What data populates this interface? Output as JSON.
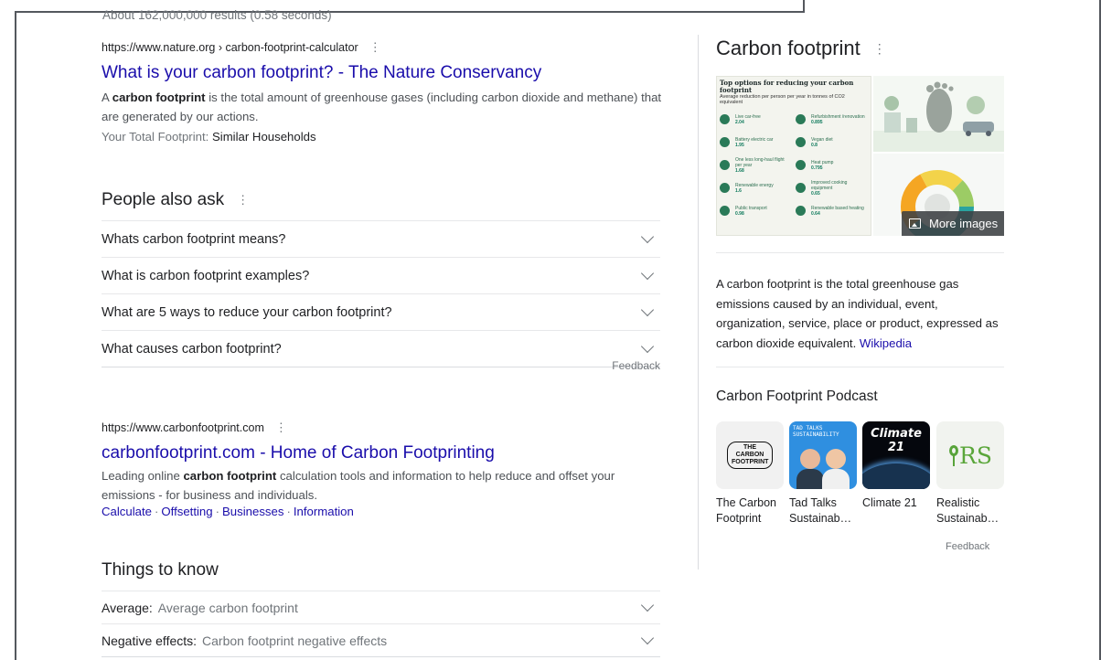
{
  "stats": "About 162,000,000 results (0.58 seconds)",
  "result1": {
    "cite": "https://www.nature.org › carbon-footprint-calculator",
    "title": "What is your carbon footprint? - The Nature Conservancy",
    "snippet_pre": "A ",
    "snippet_bold": "carbon footprint",
    "snippet_post": " is the total amount of greenhouse gases (including carbon dioxide and methane) that are generated by our actions.",
    "extra_label": "Your Total Footprint: ",
    "extra_value": "Similar Households"
  },
  "paa": {
    "title": "People also ask",
    "questions": [
      "Whats carbon footprint means?",
      "What is carbon footprint examples?",
      "What are 5 ways to reduce your carbon footprint?",
      "What causes carbon footprint?"
    ],
    "feedback": "Feedback"
  },
  "result2": {
    "cite": "https://www.carbonfootprint.com",
    "title": "carbonfootprint.com - Home of Carbon Footprinting",
    "snippet_pre": "Leading online ",
    "snippet_bold": "carbon footprint",
    "snippet_post": " calculation tools and information to help reduce and offset your emissions - for business and individuals.",
    "sitelinks": [
      "Calculate",
      "Offsetting",
      "Businesses",
      "Information"
    ]
  },
  "things_to_know": {
    "title": "Things to know",
    "items": [
      {
        "label": "Average:",
        "value": "Average carbon footprint"
      },
      {
        "label": "Negative effects:",
        "value": "Carbon footprint negative effects"
      }
    ]
  },
  "knowledge_panel": {
    "title": "Carbon footprint",
    "infographic": {
      "heading": "Top options for reducing your carbon footprint",
      "subheading": "Average reduction per person per year in tonnes of CO2 equivalent",
      "items": [
        {
          "label": "Live car-free",
          "value": "2.04"
        },
        {
          "label": "Refurbishment /renovation",
          "value": "0.895"
        },
        {
          "label": "Battery electric car",
          "value": "1.95"
        },
        {
          "label": "Vegan diet",
          "value": "0.8"
        },
        {
          "label": "One less long-haul flight per year",
          "value": "1.68"
        },
        {
          "label": "Heat pump",
          "value": "0.795"
        },
        {
          "label": "Renewable energy",
          "value": "1.6"
        },
        {
          "label": "Improved cooking equipment",
          "value": "0.65"
        },
        {
          "label": "Public transport",
          "value": "0.98"
        },
        {
          "label": "Renewable based heating",
          "value": "0.64"
        }
      ]
    },
    "more_images": "More images",
    "description": "A carbon footprint is the total greenhouse gas emissions caused by an individual, event, organization, service, place or product, expressed as carbon dioxide equivalent.",
    "source_link": "Wikipedia",
    "podcast_title": "Carbon Footprint Podcast",
    "podcasts": [
      {
        "name": "The Carbon Footprint",
        "art": "THE CARBON FOOTPRINT"
      },
      {
        "name": "Tad Talks Sustainab…",
        "art": "TAD TALKS SUSTAINABILITY"
      },
      {
        "name": "Climate 21",
        "art": "Climate 21"
      },
      {
        "name": "Realistic Sustainab…",
        "art": "RS"
      }
    ],
    "feedback": "Feedback"
  }
}
